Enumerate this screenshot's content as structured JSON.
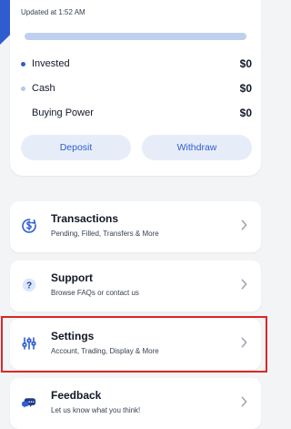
{
  "account_summary": {
    "updated_text": "Updated at 1:52 AM",
    "progress_fraction": 0.0,
    "rows": [
      {
        "label": "Invested",
        "value": "$0",
        "dot_color": "#2f5dd0"
      },
      {
        "label": "Cash",
        "value": "$0",
        "dot_color": "#b9c7e6"
      },
      {
        "label": "Buying Power",
        "value": "$0"
      }
    ],
    "deposit_label": "Deposit",
    "withdraw_label": "Withdraw"
  },
  "menu": [
    {
      "title": "Transactions",
      "subtitle": "Pending, Filled, Transfers & More",
      "icon": "transactions-icon"
    },
    {
      "title": "Support",
      "subtitle": "Browse FAQs or contact us",
      "icon": "help-icon"
    },
    {
      "title": "Settings",
      "subtitle": "Account, Trading, Display & More",
      "icon": "sliders-icon"
    },
    {
      "title": "Feedback",
      "subtitle": "Let us know what you think!",
      "icon": "chat-bubbles-icon"
    }
  ],
  "colors": {
    "accent": "#2f5dd0",
    "highlight": "#dc2626",
    "background": "#f3f4f6",
    "button_bg": "#e7edf8"
  }
}
